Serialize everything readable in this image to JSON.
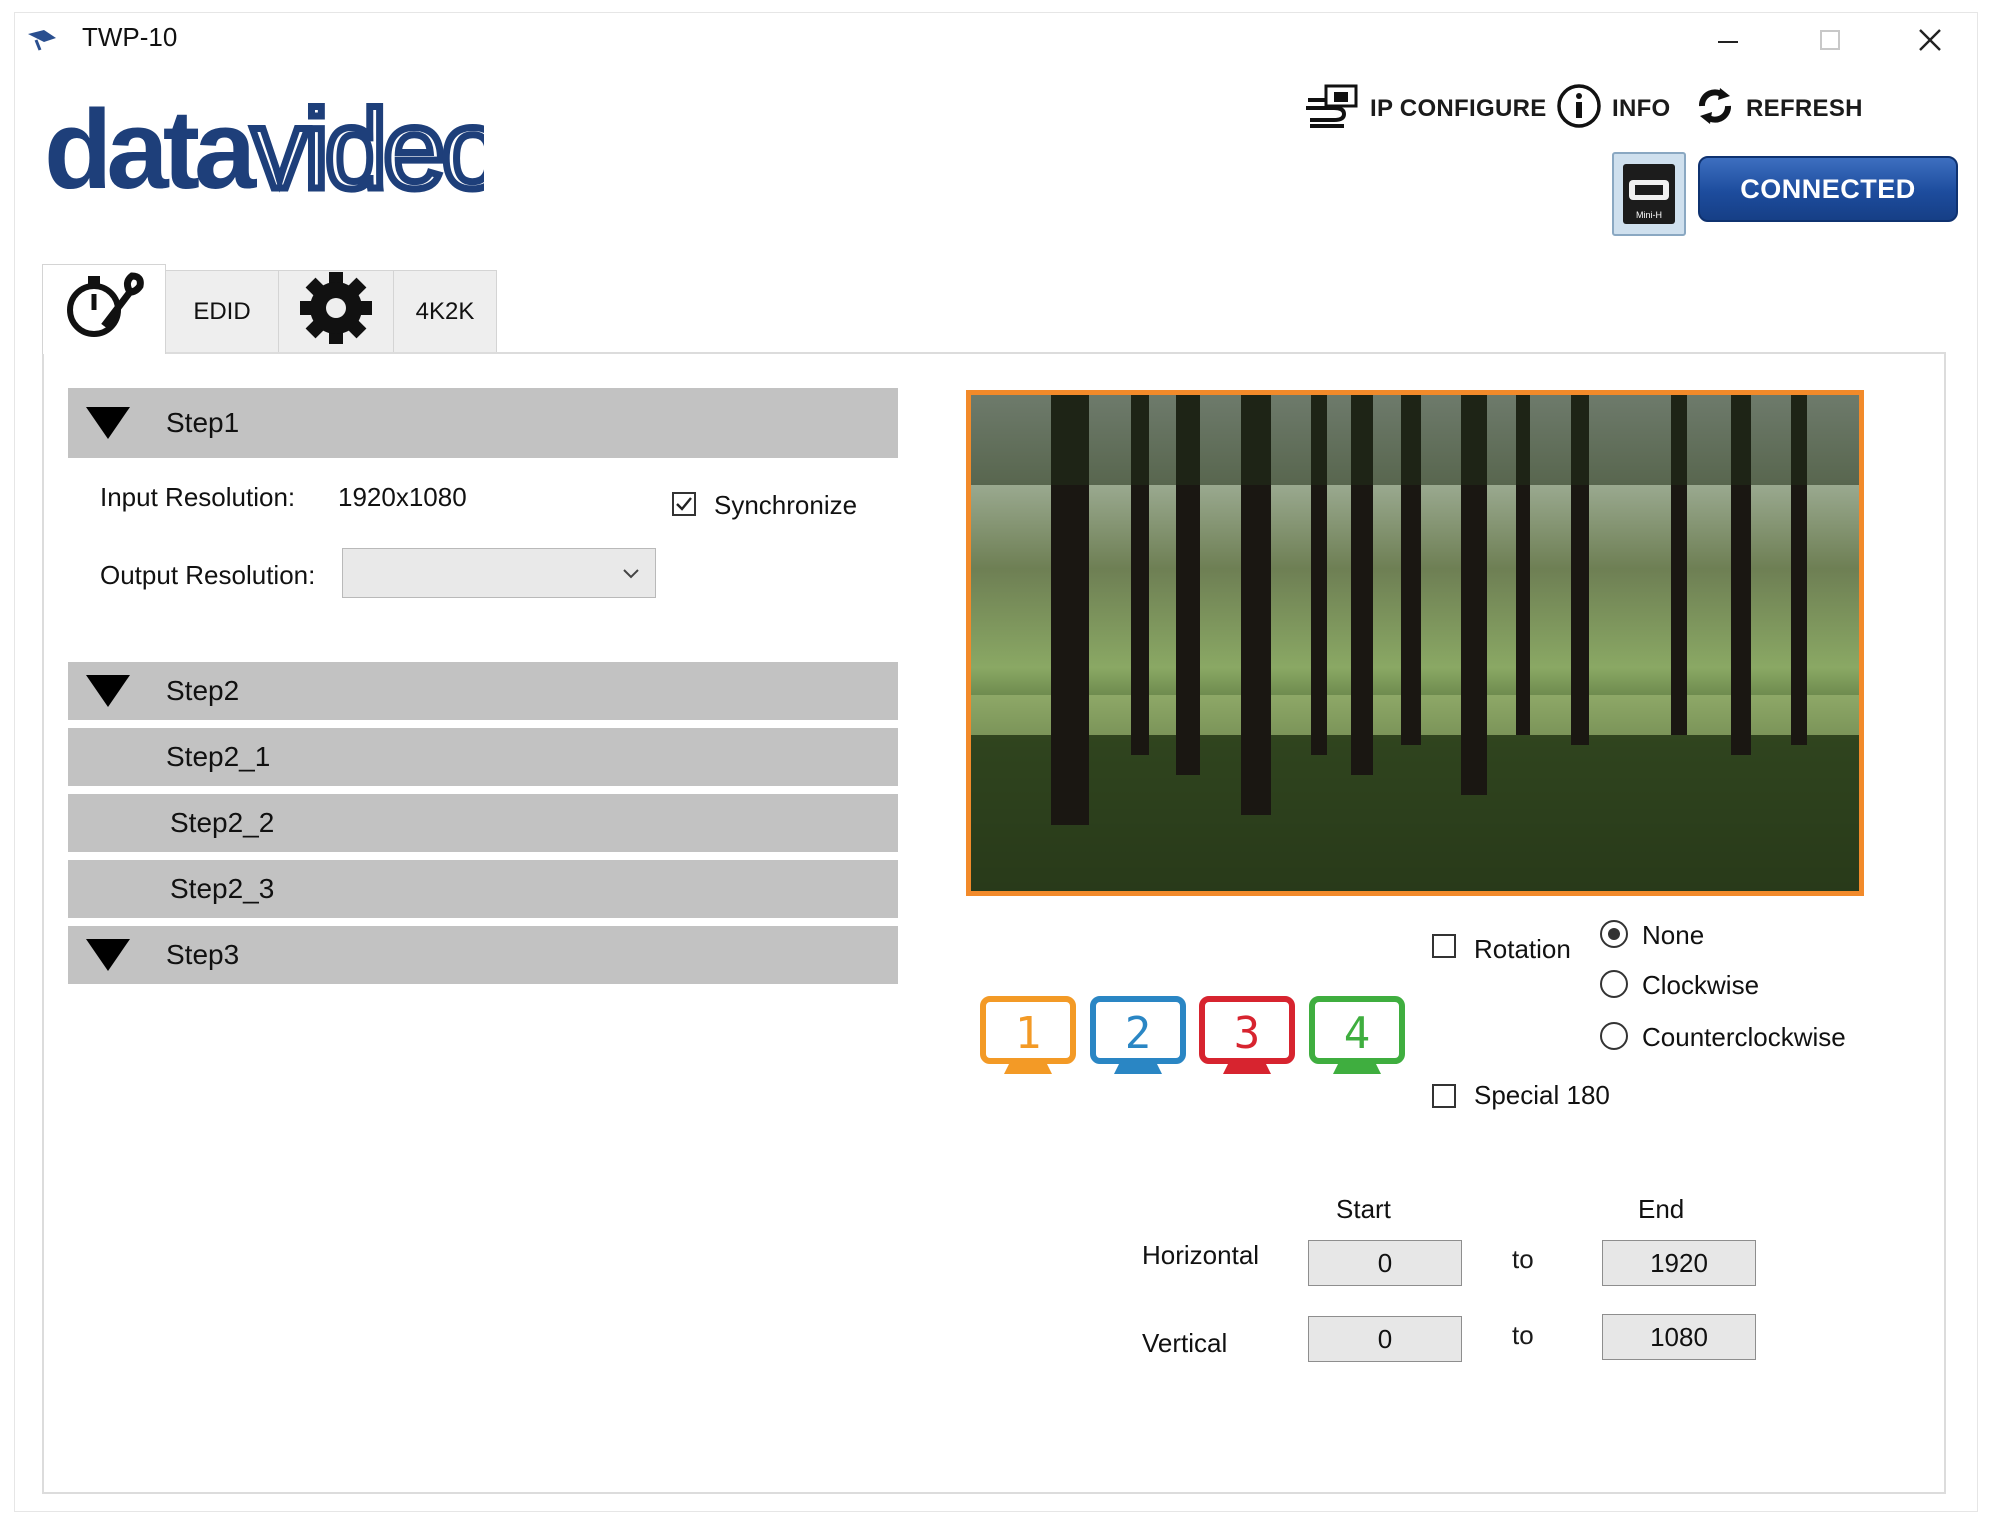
{
  "app": {
    "title": "TWP-10",
    "logo_text": "datavideo"
  },
  "toolbar": {
    "ip_configure": "IP CONFIGURE",
    "info": "INFO",
    "refresh": "REFRESH",
    "connection_status": "CONNECTED",
    "mini_hdmi_caption": "Mini-H"
  },
  "tabs": [
    {
      "id": "tools",
      "icon": "stopwatch-wrench-icon"
    },
    {
      "id": "edid",
      "label": "EDID"
    },
    {
      "id": "settings",
      "icon": "gear-icon"
    },
    {
      "id": "4k2k",
      "label": "4K2K"
    }
  ],
  "steps": {
    "step1": "Step1",
    "step2": "Step2",
    "step2_1": "Step2_1",
    "step2_2": "Step2_2",
    "step2_3": "Step2_3",
    "step3": "Step3"
  },
  "step1": {
    "input_resolution_label": "Input Resolution:",
    "input_resolution_value": "1920x1080",
    "output_resolution_label": "Output Resolution:",
    "output_resolution_value": "",
    "synchronize_label": "Synchronize",
    "synchronize_checked": true
  },
  "monitors": [
    {
      "label": "1",
      "color": "#f39a26"
    },
    {
      "label": "2",
      "color": "#2a86c4"
    },
    {
      "label": "3",
      "color": "#d7242f"
    },
    {
      "label": "4",
      "color": "#3fae3f"
    }
  ],
  "rotation": {
    "rotation_label": "Rotation",
    "rotation_checked": false,
    "options": [
      "None",
      "Clockwise",
      "Counterclockwise"
    ],
    "selected": "None",
    "special_label": "Special 180",
    "special_checked": false
  },
  "range": {
    "start_label": "Start",
    "end_label": "End",
    "to_label": "to",
    "horizontal_label": "Horizontal",
    "vertical_label": "Vertical",
    "horizontal_start": "0",
    "horizontal_end": "1920",
    "vertical_start": "0",
    "vertical_end": "1080"
  },
  "colors": {
    "preview_border": "#f28a2a",
    "connected_button": "#1d4c9d",
    "step_bar": "#c2c2c2"
  }
}
